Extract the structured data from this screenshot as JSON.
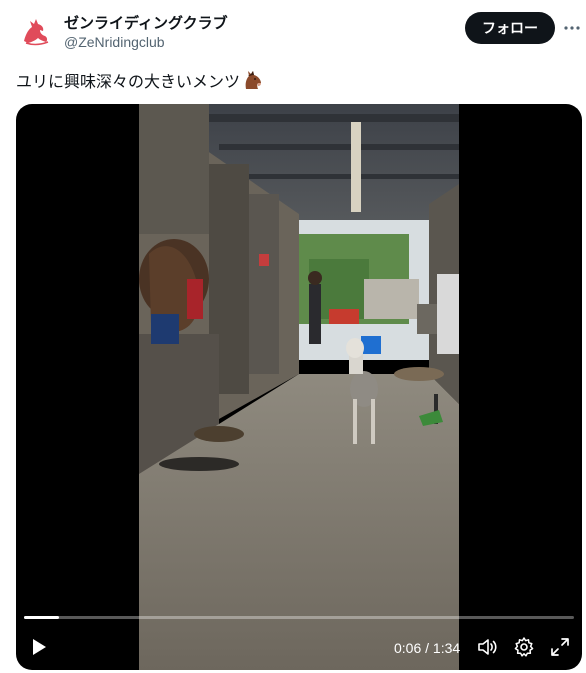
{
  "account": {
    "name": "ゼンライディングクラブ",
    "handle": "@ZeNridingclub",
    "follow_label": "フォロー",
    "avatar_icon": "horse-logo-icon",
    "avatar_color": "#e04b5a"
  },
  "tweet": {
    "text": "ユリに興味深々の大きいメンツ",
    "emoji": "horse-face-emoji"
  },
  "video": {
    "current_time": "0:06",
    "separator": " / ",
    "duration": "1:34",
    "progress": 0.064,
    "icons": {
      "play": "play-icon",
      "volume": "volume-icon",
      "settings": "gear-icon",
      "fullscreen": "fullscreen-icon"
    }
  }
}
